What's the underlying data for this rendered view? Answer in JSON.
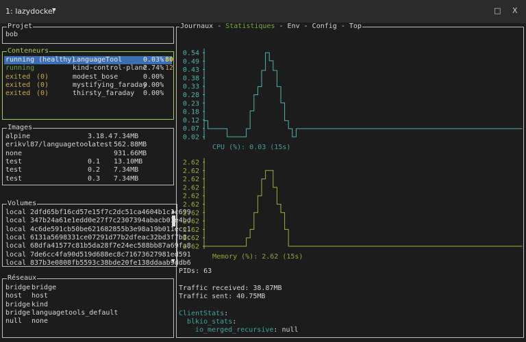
{
  "window": {
    "title": "1: lazydocker",
    "dropdown_icon": "caret-down-icon",
    "maximize_icon": "maximize-icon",
    "close_icon": "close-icon",
    "maximize_glyph": "□",
    "close_glyph": "X"
  },
  "project": {
    "title": "Projet",
    "name": "bob"
  },
  "containers": {
    "title": "Conteneurs",
    "rows": [
      {
        "status": "running (healthy)",
        "exit": "",
        "name": "LanguageTool",
        "cpu": "0.03%",
        "extra": "80",
        "selected": true
      },
      {
        "status": "running",
        "exit": "",
        "name": "kind-control-plane",
        "cpu": "2.74%",
        "extra": "12",
        "selected": false
      },
      {
        "status": "exited",
        "exit": "(0)",
        "name": "modest_bose",
        "cpu": "0.00%",
        "extra": "",
        "selected": false
      },
      {
        "status": "exited",
        "exit": "(0)",
        "name": "mystifying_faraday",
        "cpu": "0.00%",
        "extra": "",
        "selected": false
      },
      {
        "status": "exited",
        "exit": "(0)",
        "name": "thirsty_faraday",
        "cpu": "0.00%",
        "extra": "",
        "selected": false
      }
    ]
  },
  "images": {
    "title": "Images",
    "rows": [
      {
        "name": "alpine",
        "tag": "3.18.4",
        "size": "7.34MB"
      },
      {
        "name": "erikvl87/languagetool",
        "tag": "latest",
        "size": "562.88MB"
      },
      {
        "name": "none",
        "tag": "",
        "size": "931.66MB"
      },
      {
        "name": "test",
        "tag": "0.1",
        "size": "13.10MB"
      },
      {
        "name": "test",
        "tag": "0.2",
        "size": "7.34MB"
      },
      {
        "name": "test",
        "tag": "0.3",
        "size": "7.34MB"
      }
    ]
  },
  "volumes": {
    "title": "Volumes",
    "scroll_up": "▲",
    "scroll_down": "▼",
    "rows": [
      {
        "driver": "local",
        "name": "2dfd65bf16cd57e15f7c2dc51ca4604b1c1c699"
      },
      {
        "driver": "local",
        "name": "347b24a61e1edd0e27f7c2307394abacb01e4bd"
      },
      {
        "driver": "local",
        "name": "4c6de591cb50be621682855b3e98a19b011ecc1"
      },
      {
        "driver": "local",
        "name": "6131a5698331ce07291d77b2dfeac32bd3f7b8c"
      },
      {
        "driver": "local",
        "name": "68dfa41577c81b5da28f7e24ec588bb87a69fa8"
      },
      {
        "driver": "local",
        "name": "7de6cc4fa90d519d688ec8c71673627981ed591"
      },
      {
        "driver": "local",
        "name": "837b3e0808fb5593c38bde20fe138ddaab9ddb6"
      }
    ]
  },
  "networks": {
    "title": "Réseaux",
    "rows": [
      {
        "driver": "bridge",
        "name": "bridge"
      },
      {
        "driver": "host",
        "name": "host"
      },
      {
        "driver": "bridge",
        "name": "kind"
      },
      {
        "driver": "bridge",
        "name": "languagetools_default"
      },
      {
        "driver": "null",
        "name": "none"
      }
    ]
  },
  "main": {
    "tabs": [
      {
        "label": "Journaux",
        "active": false
      },
      {
        "label": "Statistiques",
        "active": true
      },
      {
        "label": "Env",
        "active": false
      },
      {
        "label": "Config",
        "active": false
      },
      {
        "label": "Top",
        "active": false
      }
    ],
    "separator": " - ",
    "pids": "PIDs: 63",
    "traffic_received": "Traffic received: 38.87MB",
    "traffic_sent": "Traffic sent: 40.75MB",
    "client_stats_key": "ClientStats",
    "blkio_key": "blkio_stats",
    "io_merged_key": "io_merged_recursive",
    "io_merged_value": "null"
  },
  "colors": {
    "cpu": "#4fb3a6",
    "memory": "#9bb03c",
    "selected_bg": "#3c6eb4",
    "active_border": "#a6c95a"
  },
  "chart_data": [
    {
      "type": "line",
      "title": "CPU (%): 0.03 (15s)",
      "yticks": [
        "0.54",
        "0.49",
        "0.43",
        "0.38",
        "0.33",
        "0.28",
        "0.23",
        "0.18",
        "0.12",
        "0.07",
        "0.02"
      ],
      "ylim": [
        0.02,
        0.54
      ],
      "values": [
        0.12,
        0.07,
        0.07,
        0.07,
        0.07,
        0.07,
        0.02,
        0.02,
        0.02,
        0.02,
        0.02,
        0.07,
        0.18,
        0.28,
        0.33,
        0.43,
        0.54,
        0.49,
        0.43,
        0.33,
        0.23,
        0.12,
        0.07,
        0.02,
        0.07,
        0.07,
        0.07,
        0.07,
        0.07,
        0.07,
        0.07,
        0.07,
        0.07,
        0.07,
        0.07,
        0.07,
        0.07,
        0.07,
        0.07,
        0.07,
        0.07,
        0.07,
        0.07,
        0.07,
        0.07,
        0.07,
        0.07,
        0.07,
        0.07,
        0.07,
        0.07,
        0.07,
        0.07,
        0.07,
        0.07,
        0.07,
        0.07,
        0.07,
        0.07,
        0.07,
        0.07,
        0.07,
        0.07,
        0.07,
        0.07,
        0.07,
        0.07,
        0.07,
        0.07,
        0.07,
        0.07,
        0.07,
        0.07,
        0.07,
        0.07,
        0.07,
        0.07,
        0.07,
        0.07,
        0.07,
        0.07,
        0.07,
        0.07
      ]
    },
    {
      "type": "line",
      "title": "Memory (%): 2.62 (15s)",
      "yticks": [
        "2.62",
        "2.62",
        "2.62",
        "2.62",
        "2.62",
        "2.62",
        "2.62",
        "2.62",
        "2.62",
        "2.62",
        "2.62"
      ],
      "ylim": [
        2.62,
        2.621
      ],
      "values": [
        2.62,
        2.62,
        2.62,
        2.62,
        2.62,
        2.62,
        2.62,
        2.62,
        2.62,
        2.62,
        2.62,
        2.6201,
        2.6202,
        2.6204,
        2.6206,
        2.6208,
        2.6209,
        2.6209,
        2.6207,
        2.6205,
        2.6204,
        2.6202,
        2.62,
        2.62,
        2.62,
        2.62,
        2.62,
        2.62,
        2.62,
        2.62,
        2.62,
        2.62,
        2.62,
        2.62,
        2.62,
        2.62,
        2.62,
        2.62,
        2.62,
        2.62,
        2.62,
        2.62,
        2.62,
        2.62,
        2.62,
        2.62,
        2.62,
        2.62,
        2.62,
        2.62,
        2.62,
        2.62,
        2.62,
        2.62,
        2.62,
        2.62,
        2.62,
        2.62,
        2.62,
        2.62,
        2.62,
        2.62,
        2.62,
        2.62,
        2.62,
        2.62,
        2.62,
        2.62,
        2.62,
        2.62,
        2.62,
        2.62,
        2.62,
        2.62,
        2.62,
        2.62,
        2.62,
        2.62,
        2.62,
        2.62,
        2.62,
        2.62,
        2.62
      ]
    }
  ]
}
